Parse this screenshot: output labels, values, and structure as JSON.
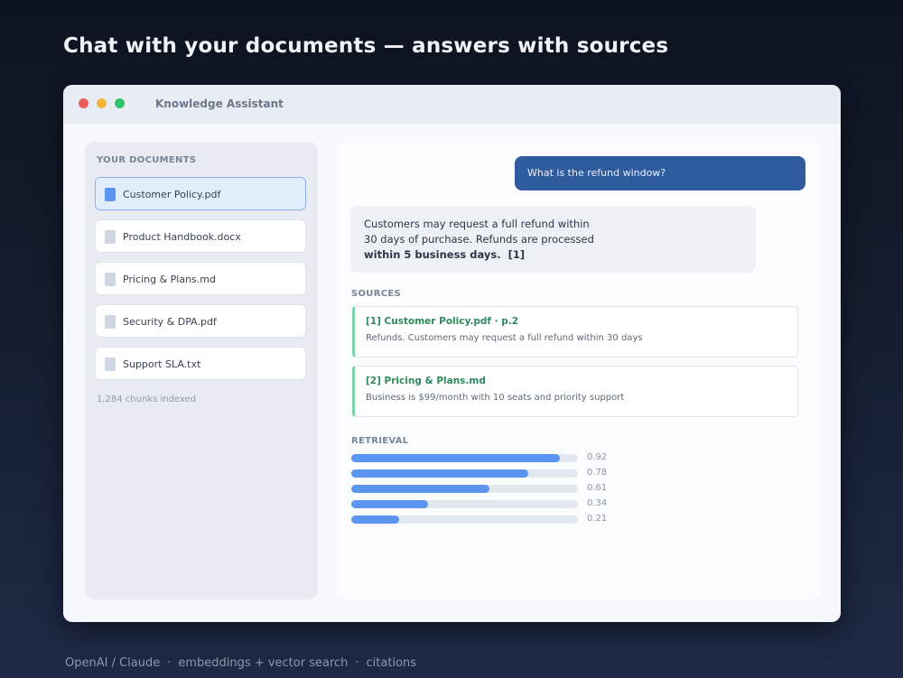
{
  "page": {
    "title": "Chat with your documents — answers with sources"
  },
  "window": {
    "title": "Knowledge Assistant",
    "controls": [
      "close",
      "minimize",
      "maximize"
    ]
  },
  "sidebar": {
    "heading": "YOUR DOCUMENTS",
    "documents": [
      {
        "label": "Customer Policy.pdf",
        "active": true,
        "icon": "file-icon"
      },
      {
        "label": "Product Handbook.docx",
        "active": false,
        "icon": "file-icon"
      },
      {
        "label": "Pricing & Plans.md",
        "active": false,
        "icon": "file-icon"
      },
      {
        "label": "Security & DPA.pdf",
        "active": false,
        "icon": "file-icon"
      },
      {
        "label": "Support SLA.txt",
        "active": false,
        "icon": "file-icon"
      }
    ],
    "chunks_indexed": "1,284 chunks indexed"
  },
  "chat": {
    "user_message": "What is the refund window?",
    "assistant_message": {
      "line1": "Customers may request a full refund within",
      "line2": "30 days of purchase. Refunds are processed",
      "line3_bold": "within 5 business days.",
      "citation": "[1]"
    },
    "sources_heading": "SOURCES",
    "sources": [
      {
        "title": "[1]  Customer Policy.pdf · p.2",
        "snippet": "Refunds. Customers may request a full refund within 30 days"
      },
      {
        "title": "[2]  Pricing & Plans.md",
        "snippet": "Business is $99/month with 10 seats and priority support"
      }
    ],
    "retrieval_heading": "RETRIEVAL",
    "retrieval_scores": [
      {
        "score": 0.92,
        "label": "0.92"
      },
      {
        "score": 0.78,
        "label": "0.78"
      },
      {
        "score": 0.61,
        "label": "0.61"
      },
      {
        "score": 0.34,
        "label": "0.34"
      },
      {
        "score": 0.21,
        "label": "0.21"
      }
    ]
  },
  "footer": {
    "items": [
      "OpenAI / Claude",
      "embeddings + vector search",
      "citations"
    ],
    "separator": "·"
  },
  "colors": {
    "accent": "#5b95ef",
    "user_bubble": "#2f5b9f",
    "source_accent": "#7bd3a8",
    "source_title": "#2e8a5c"
  }
}
